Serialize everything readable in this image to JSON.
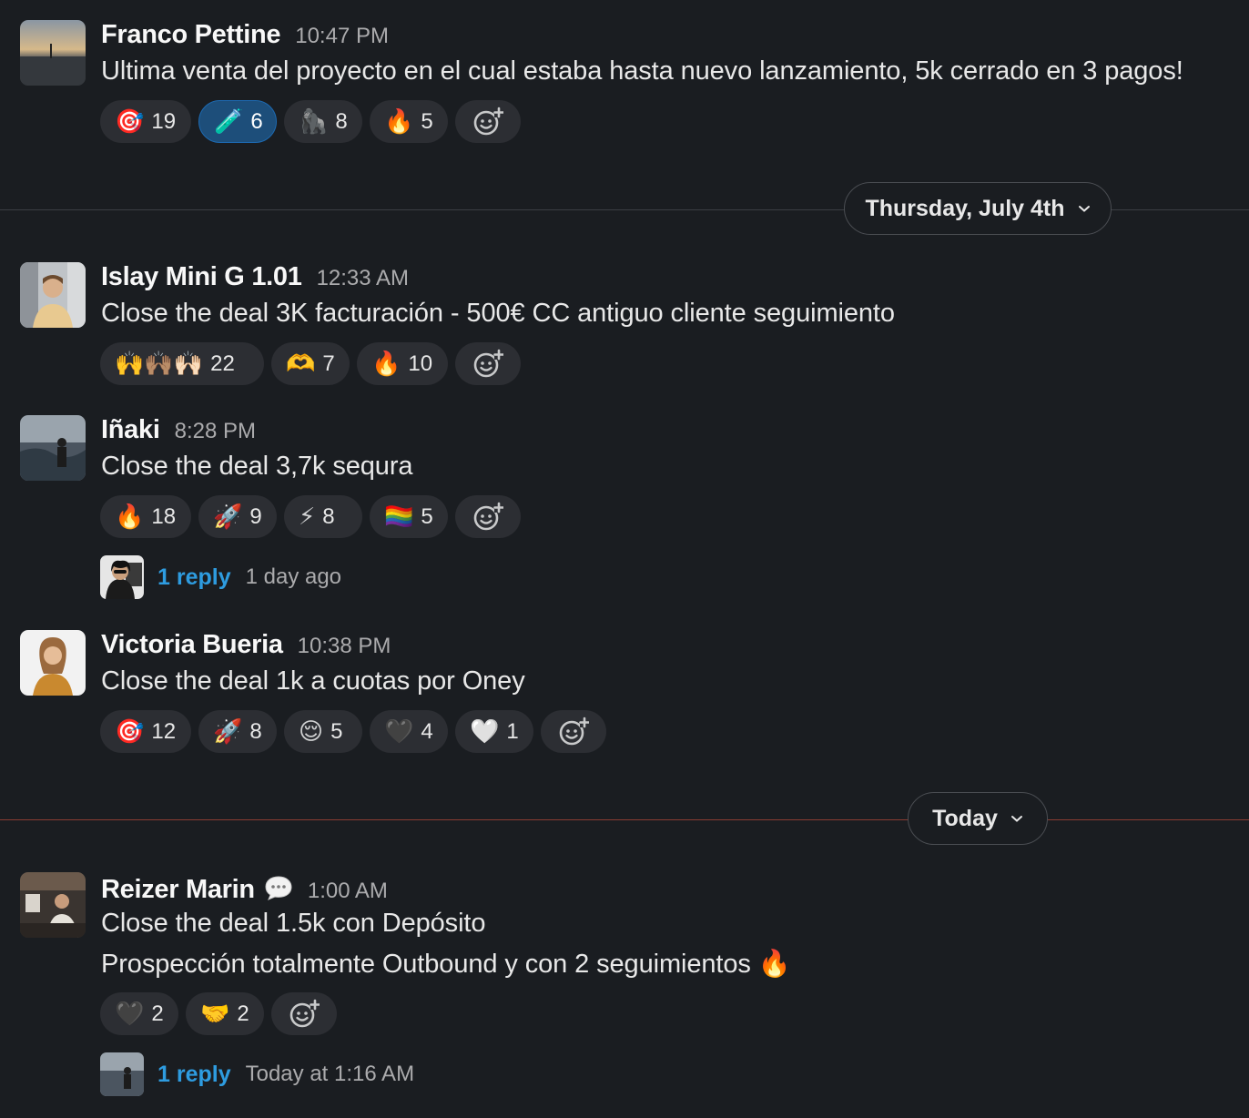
{
  "messages": [
    {
      "author": "Franco Pettine",
      "time": "10:47 PM",
      "lines": [
        "Ultima venta del proyecto en el cual estaba hasta nuevo lanzamiento, 5k cerrado en 3 pagos!"
      ],
      "reactions": [
        {
          "emoji": "🎯",
          "count": "19",
          "icon": "target-emoji"
        },
        {
          "emoji": "🧪",
          "count": "6",
          "icon": "test-tube-emoji",
          "active": true
        },
        {
          "emoji": "🦍",
          "count": "8",
          "icon": "gorilla-emoji"
        },
        {
          "emoji": "🔥",
          "count": "5",
          "icon": "fire-emoji"
        }
      ]
    },
    {
      "author": "Islay Mini G 1.01",
      "time": "12:33 AM",
      "lines": [
        "Close the deal 3K facturación - 500€ CC antiguo cliente seguimiento"
      ],
      "reactions": [
        {
          "emoji": "🙌🙌🏽🙌🏻",
          "count": "22",
          "icon": "raised-hands-emoji"
        },
        {
          "emoji": "🫶",
          "count": "7",
          "icon": "heart-hands-emoji"
        },
        {
          "emoji": "🔥",
          "count": "10",
          "icon": "fire-emoji"
        }
      ]
    },
    {
      "author": "Iñaki",
      "time": "8:28 PM",
      "lines": [
        "Close the deal 3,7k sequra"
      ],
      "reactions": [
        {
          "emoji": "🔥",
          "count": "18",
          "icon": "fire-emoji"
        },
        {
          "emoji": "🚀",
          "count": "9",
          "icon": "rocket-emoji"
        },
        {
          "emoji": "⚡",
          "count": "8",
          "icon": "lightning-emoji"
        },
        {
          "emoji": "🏳️‍🌈",
          "count": "5",
          "icon": "rainbow-flag-emoji"
        }
      ],
      "thread": {
        "reply": "1 reply",
        "time": "1 day ago"
      }
    },
    {
      "author": "Victoria Bueria",
      "time": "10:38 PM",
      "lines": [
        "Close the deal 1k a cuotas por Oney"
      ],
      "reactions": [
        {
          "emoji": "🎯",
          "count": "12",
          "icon": "target-emoji"
        },
        {
          "emoji": "🚀",
          "count": "8",
          "icon": "rocket-emoji"
        },
        {
          "emoji": "😌",
          "count": "5",
          "icon": "relieved-face-emoji"
        },
        {
          "emoji": "🖤",
          "count": "4",
          "icon": "black-heart-emoji"
        },
        {
          "emoji": "🤍",
          "count": "1",
          "icon": "white-heart-emoji"
        }
      ]
    },
    {
      "author": "Reizer Marin",
      "time": "1:00 AM",
      "lines": [
        "Close the deal 1.5k con Depósito",
        "Prospección totalmente Outbound y con 2 seguimientos 🔥"
      ],
      "reactions": [
        {
          "emoji": "🖤",
          "count": "2",
          "icon": "black-heart-emoji"
        },
        {
          "emoji": "🤝",
          "count": "2",
          "icon": "handshake-emoji"
        }
      ],
      "thread": {
        "reply": "1 reply",
        "time": "Today at 1:16 AM"
      }
    }
  ],
  "dividers": [
    {
      "label": "Thursday, July 4th",
      "line_color": "#3b3e43"
    },
    {
      "label": "Today",
      "line_color": "#8a3c32"
    }
  ],
  "colors": {
    "background": "#1a1d21",
    "reaction_bg": "#2c2e33",
    "reaction_active_bg": "#1d4e7a",
    "link": "#2e9ce0"
  }
}
